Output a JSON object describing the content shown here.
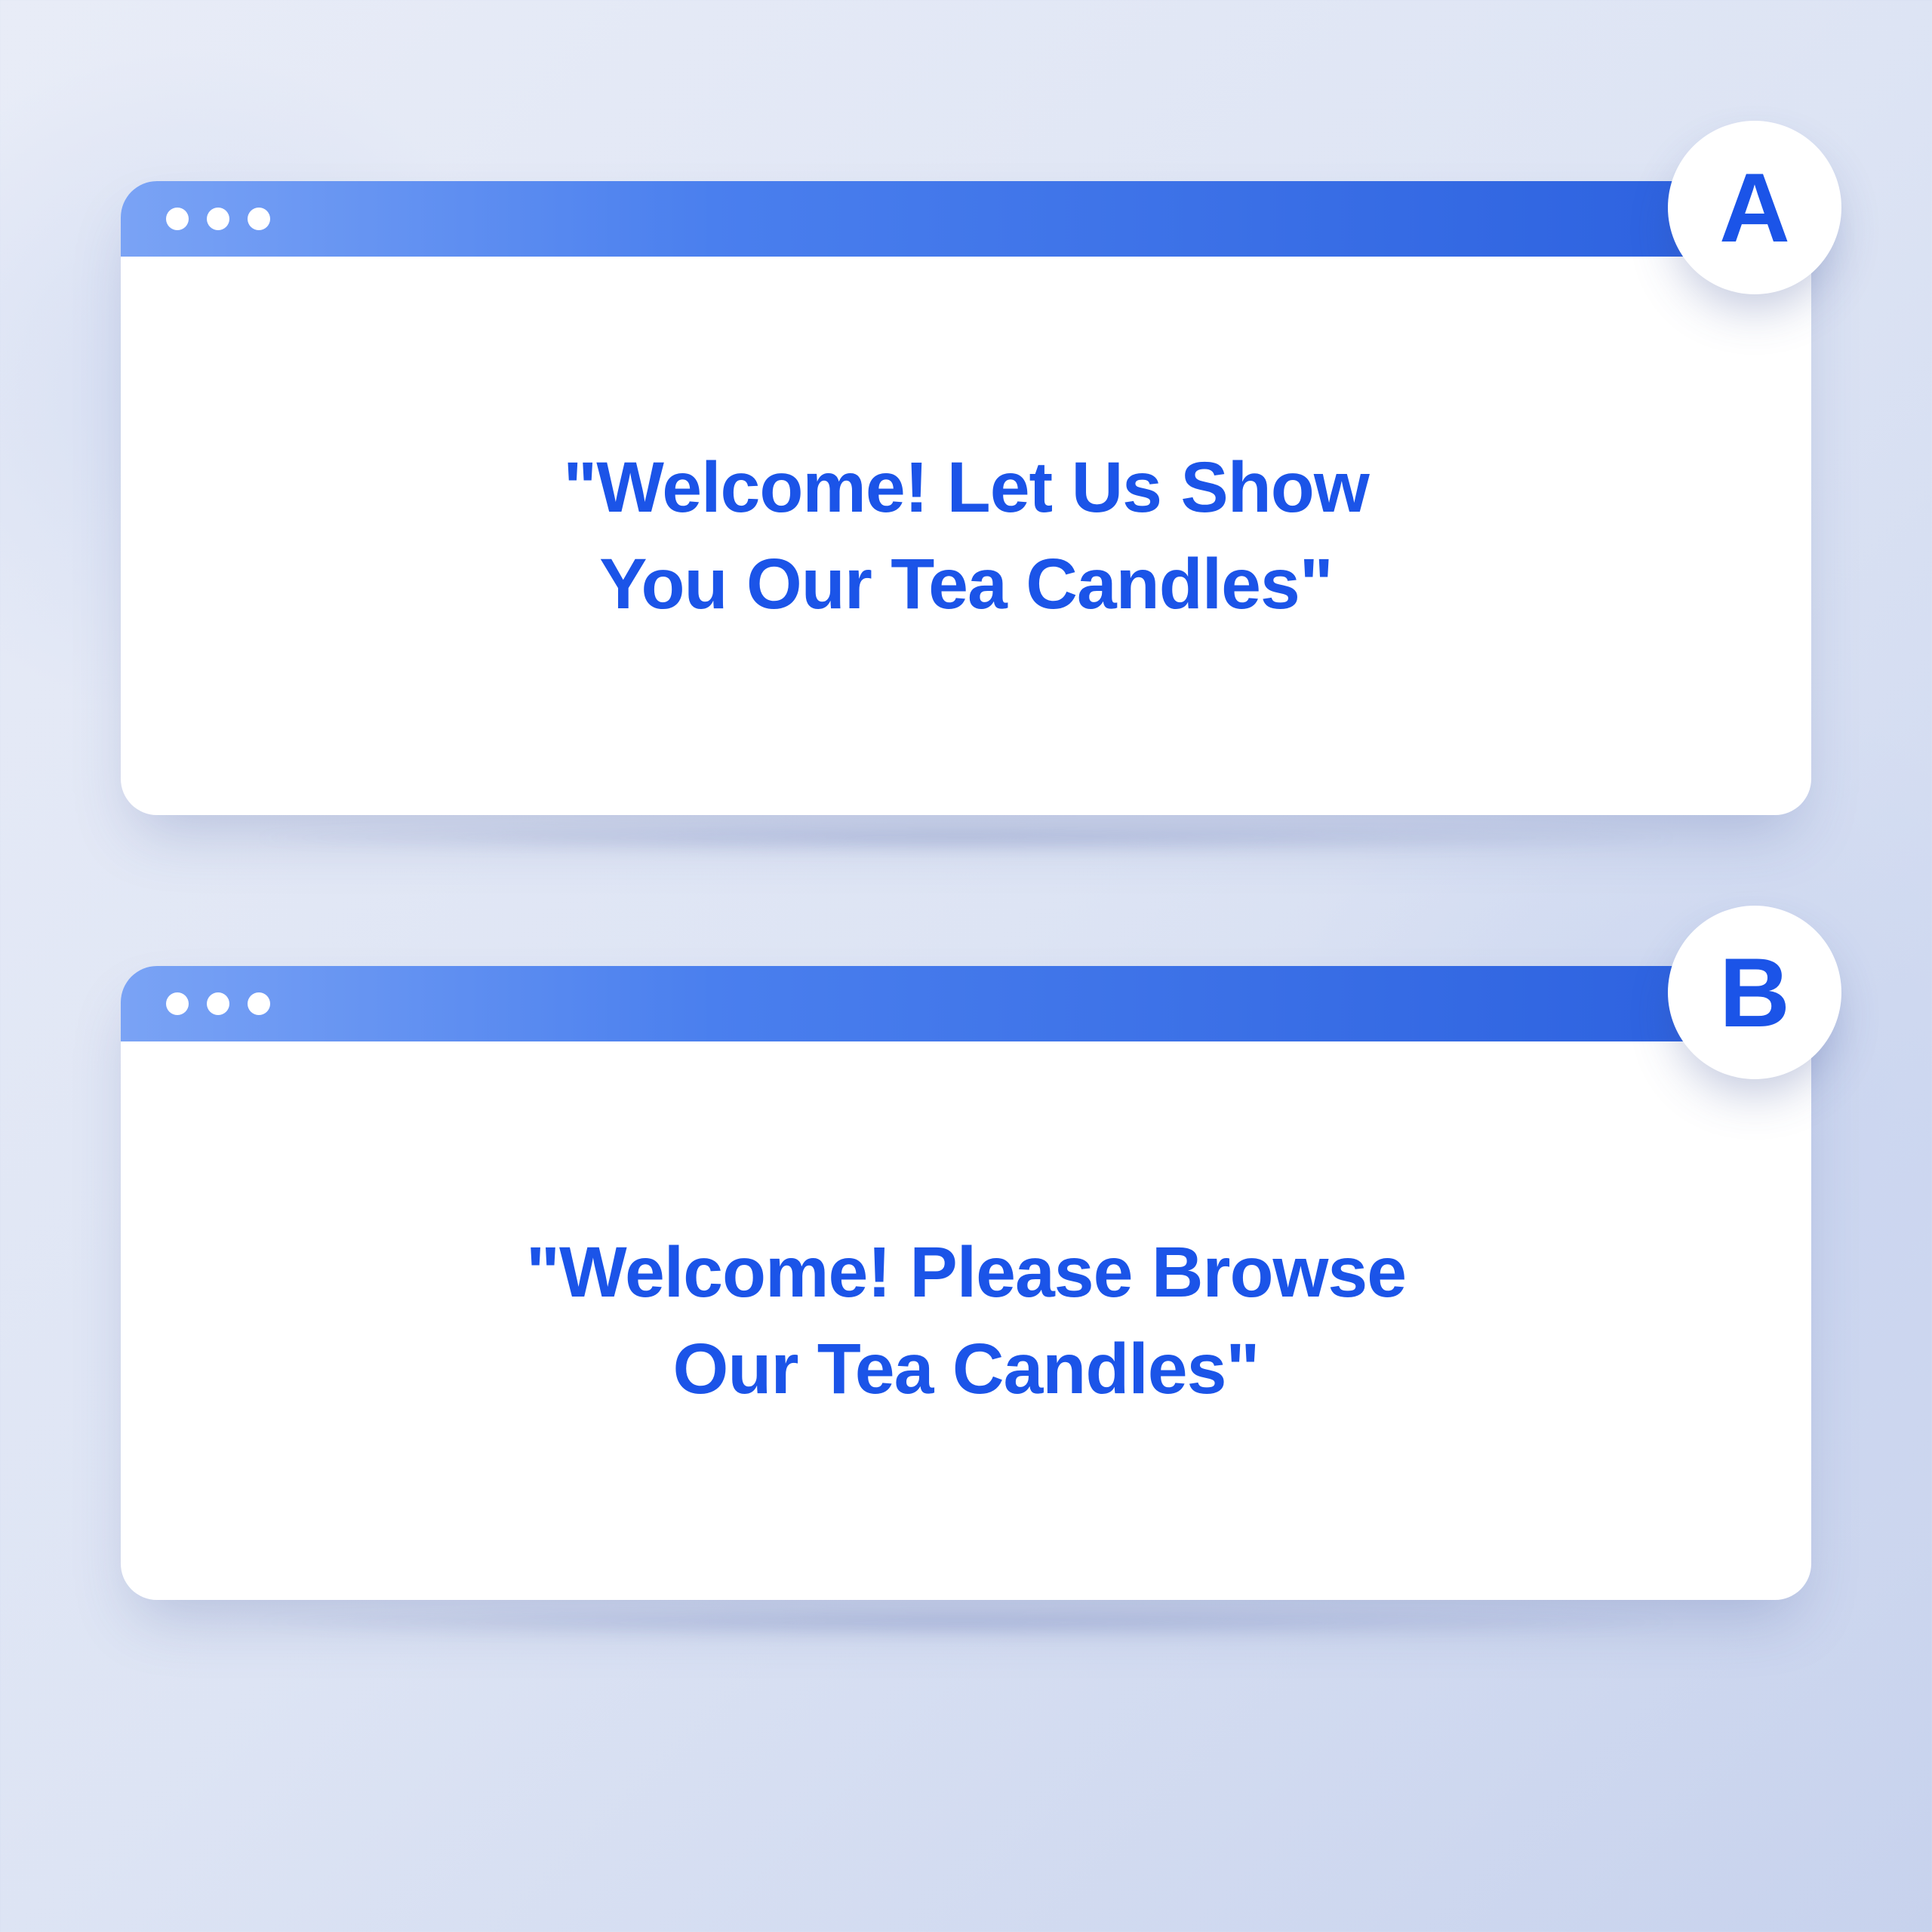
{
  "variants": [
    {
      "badge_label": "A",
      "message_line1": "\"Welcome! Let Us Show",
      "message_line2": "You Our Tea Candles\""
    },
    {
      "badge_label": "B",
      "message_line1": "\"Welcome! Please Browse",
      "message_line2": "Our Tea Candles\""
    }
  ],
  "colors": {
    "accent": "#1b54e8",
    "titlebar_start": "#7aa3f5",
    "titlebar_end": "#2a5fde",
    "background": "#e8ecf7"
  }
}
